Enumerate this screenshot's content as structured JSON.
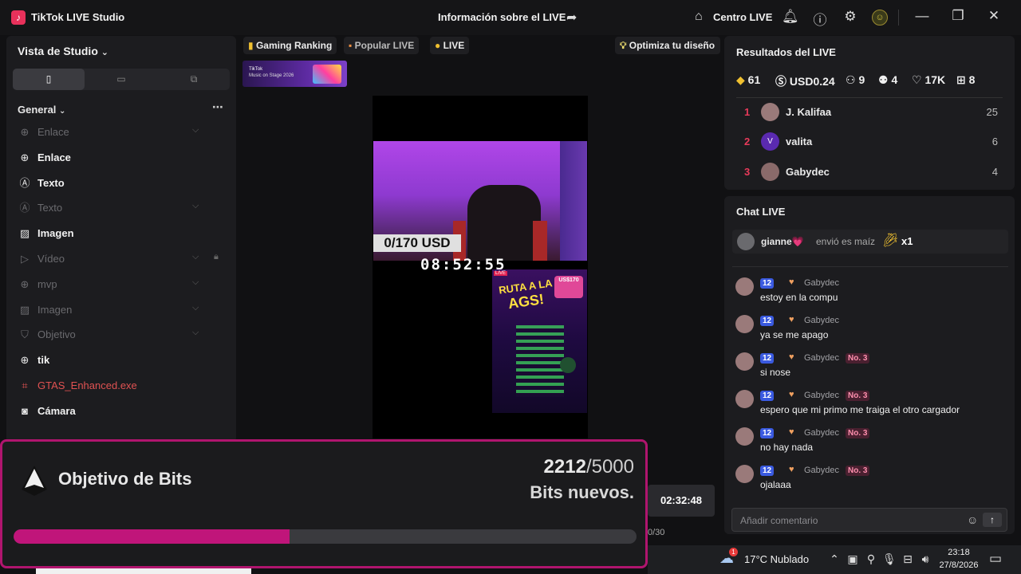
{
  "titlebar": {
    "app_title": "TikTok LIVE Studio",
    "center_title": "Información sobre el LIVE",
    "centro_label": "Centro LIVE",
    "icons": [
      "bell-icon",
      "help-icon",
      "settings-icon",
      "avatar",
      "minimize-icon",
      "restore-icon",
      "close-icon"
    ]
  },
  "left_panel": {
    "header": "Vista de Studio",
    "section": "General",
    "sources": [
      {
        "label": "Enlace",
        "icon": "globe-icon",
        "state": "dim"
      },
      {
        "label": "Enlace",
        "icon": "globe-icon",
        "state": "bright"
      },
      {
        "label": "Texto",
        "icon": "text-icon",
        "state": "bright"
      },
      {
        "label": "Texto",
        "icon": "text-icon",
        "state": "dim"
      },
      {
        "label": "Imagen",
        "icon": "image-icon",
        "state": "bright"
      },
      {
        "label": "Vídeo",
        "icon": "play-icon",
        "state": "dim"
      },
      {
        "label": "mvp",
        "icon": "globe-icon",
        "state": "dim"
      },
      {
        "label": "Imagen",
        "icon": "image-icon",
        "state": "dim"
      },
      {
        "label": "Objetivo",
        "icon": "shield-icon",
        "state": "dim"
      },
      {
        "label": "tik",
        "icon": "globe-icon",
        "state": "bright"
      },
      {
        "label": "GTAS_Enhanced.exe",
        "icon": "game-icon",
        "state": "red"
      },
      {
        "label": "Cámara",
        "icon": "camera-icon",
        "state": "bright"
      }
    ]
  },
  "center": {
    "chips": [
      {
        "label": "Gaming Ranking"
      },
      {
        "label": "Popular LIVE"
      },
      {
        "label": "LIVE"
      }
    ],
    "optimize_label": "Optimiza tu diseño",
    "banner_line1": "TikTok",
    "banner_line2": "Music on Stage 2026",
    "goal_label": "0/170 USD",
    "timer": "08:52:55",
    "poster_title1": "RUTA A LA",
    "poster_title2": "AGS!",
    "poster_tag": "US$170",
    "poster_live": "LIVE",
    "duration": "02:32:48",
    "counter": "0/30"
  },
  "overlay": {
    "title": "Objetivo de Bits",
    "current": "2212",
    "total": "/5000",
    "subtitle": "Bits nuevos.",
    "progress": 0.4424
  },
  "results": {
    "header": "Resultados del LIVE",
    "stats": [
      {
        "icon": "diamond-icon",
        "value": "61"
      },
      {
        "icon": "dollar-icon",
        "value": "USD0.24"
      },
      {
        "icon": "viewers-icon",
        "value": "9"
      },
      {
        "icon": "new-followers-icon",
        "value": "4"
      },
      {
        "icon": "heart-icon",
        "value": "17K"
      },
      {
        "icon": "gift-icon",
        "value": "8"
      }
    ],
    "ranking": [
      {
        "rank": "1",
        "name": "J. Kalifaa",
        "score": "25",
        "avatar_color": "#9a7a7a"
      },
      {
        "rank": "2",
        "name": "valita",
        "score": "6",
        "avatar_color": "#5a2ab0",
        "avatar_letter": "V"
      },
      {
        "rank": "3",
        "name": "Gabydec",
        "score": "4",
        "avatar_color": "#8a6a6a"
      }
    ]
  },
  "chat": {
    "header": "Chat LIVE",
    "gift": {
      "user": "gianne💗",
      "action": "envió es maíz",
      "count": "x1"
    },
    "messages": [
      {
        "level": "12",
        "user": "Gabydec",
        "badge": "",
        "text": "estoy en la compu"
      },
      {
        "level": "12",
        "user": "Gabydec",
        "badge": "",
        "text": "ya se me apago"
      },
      {
        "level": "12",
        "user": "Gabydec",
        "badge": "No. 3",
        "text": "si nose"
      },
      {
        "level": "12",
        "user": "Gabydec",
        "badge": "No. 3",
        "text": "espero que mi primo me traiga el otro cargador"
      },
      {
        "level": "12",
        "user": "Gabydec",
        "badge": "No. 3",
        "text": "no hay nada"
      },
      {
        "level": "12",
        "user": "Gabydec",
        "badge": "No. 3",
        "text": "ojalaaa"
      }
    ],
    "input_placeholder": "Añadir comentario"
  },
  "taskbar": {
    "weather": "17°C  Nublado",
    "time": "23:18",
    "date": "27/8/2026",
    "badge": "1"
  }
}
